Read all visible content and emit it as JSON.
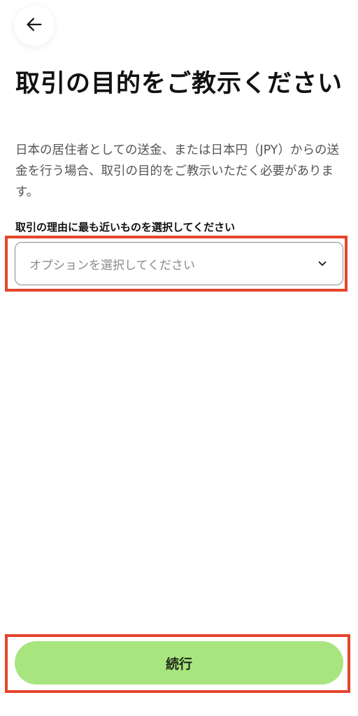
{
  "header": {
    "back_icon": "arrow-left-icon"
  },
  "page": {
    "title": "取引の目的をご教示ください",
    "description": "日本の居住者としての送金、または日本円（JPY）からの送金を行う場合、取引の目的をご教示いただく必要があります。"
  },
  "form": {
    "label": "取引の理由に最も近いものを選択してください",
    "select_placeholder": "オプションを選択してください",
    "chevron_icon": "chevron-down-icon"
  },
  "footer": {
    "continue_label": "続行"
  },
  "colors": {
    "accent_green": "#a8e57f",
    "highlight_red": "#e4452b"
  }
}
